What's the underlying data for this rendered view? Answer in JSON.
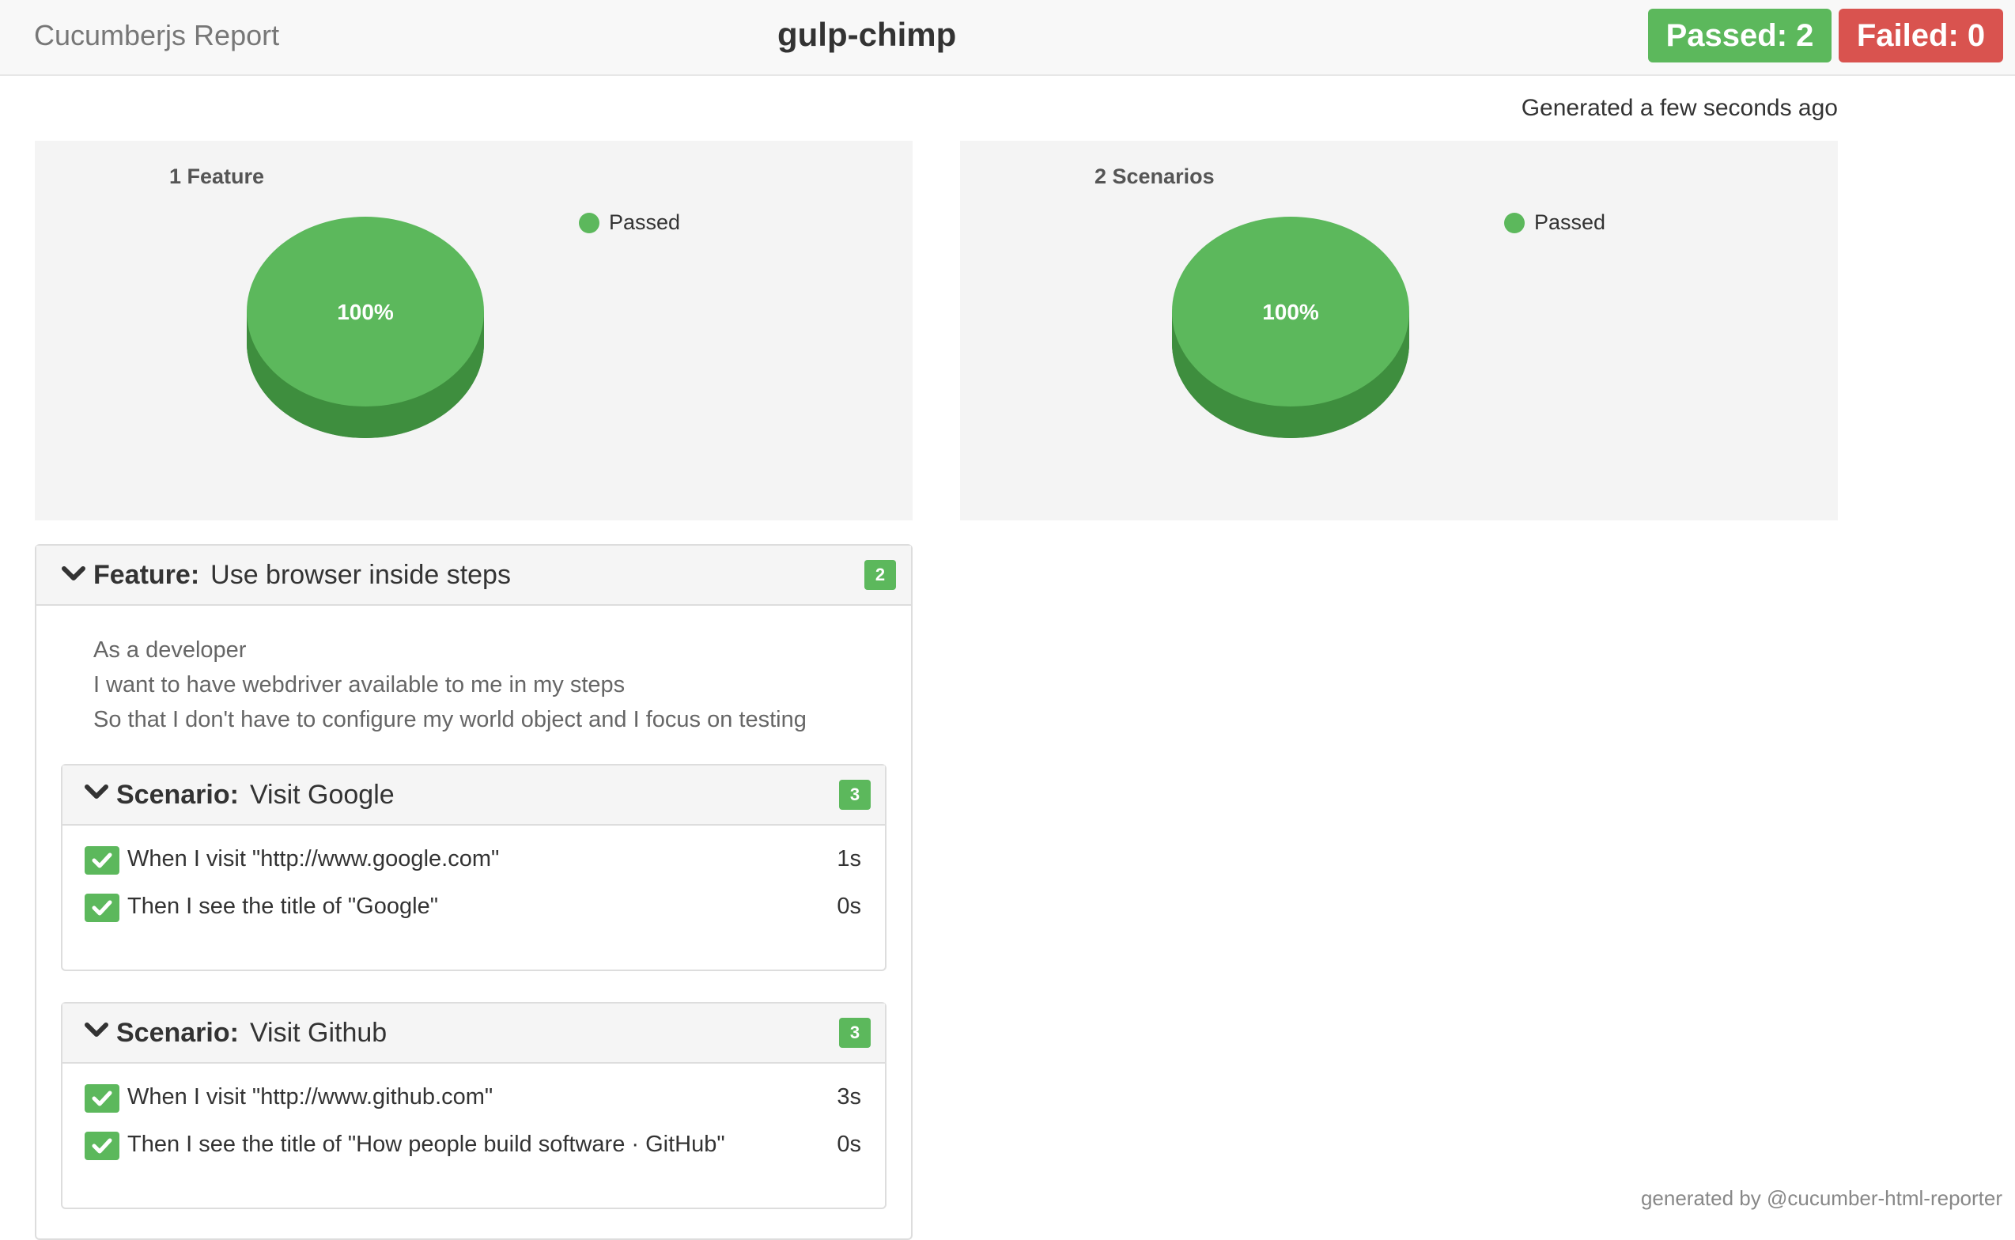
{
  "navbar": {
    "brand": "Cucumberjs Report",
    "project": "gulp-chimp",
    "passed_label": "Passed: 2",
    "failed_label": "Failed: 0"
  },
  "generated_text": "Generated a few seconds ago",
  "charts": {
    "features": {
      "title": "1 Feature",
      "legend": "Passed",
      "pct_label": "100%"
    },
    "scenarios": {
      "title": "2 Scenarios",
      "legend": "Passed",
      "pct_label": "100%"
    }
  },
  "feature": {
    "keyword": "Feature:",
    "name": "Use browser inside steps",
    "count": "2",
    "description": [
      "As a developer",
      "I want to have webdriver available to me in my steps",
      "So that I don't have to configure my world object and I focus on testing"
    ],
    "scenarios": [
      {
        "keyword": "Scenario:",
        "name": "Visit Google",
        "count": "3",
        "steps": [
          {
            "text": "When I visit \"http://www.google.com\"",
            "duration": "1s"
          },
          {
            "text": "Then I see the title of \"Google\"",
            "duration": "0s"
          }
        ]
      },
      {
        "keyword": "Scenario:",
        "name": "Visit Github",
        "count": "3",
        "steps": [
          {
            "text": "When I visit \"http://www.github.com\"",
            "duration": "3s"
          },
          {
            "text": "Then I see the title of \"How people build software · GitHub\"",
            "duration": "0s"
          }
        ]
      }
    ]
  },
  "footer": "generated by @cucumber-html-reporter",
  "colors": {
    "passed": "#5cb85c",
    "passed_dark": "#3e8e3e",
    "failed": "#d9534f"
  }
}
